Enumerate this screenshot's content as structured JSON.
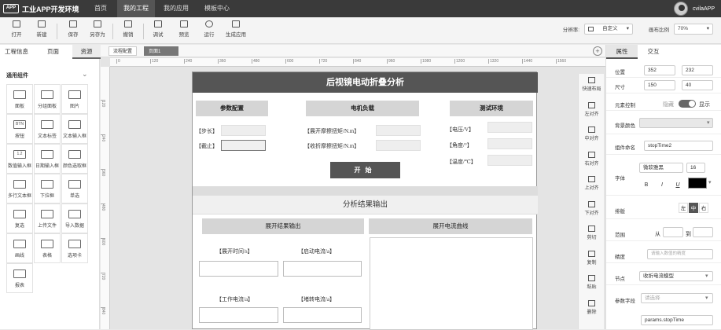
{
  "app": {
    "title": "工业APP开发环境",
    "logo_text": "APP"
  },
  "nav": {
    "tabs": [
      "首页",
      "我的工程",
      "我的应用",
      "模板中心"
    ],
    "active": 1
  },
  "user": {
    "name": "cvilaAPP"
  },
  "toolbar": {
    "buttons": [
      "打开",
      "新建",
      "保存",
      "另存为",
      "撤销",
      "调试",
      "预览",
      "运行",
      "生成应用"
    ],
    "resolution_label": "分辨率:",
    "resolution_value": "自定义",
    "zoom_label": "画布比例",
    "zoom_value": "70%"
  },
  "left_panel": {
    "tabs": [
      "工程信息",
      "页面",
      "资源"
    ],
    "active_tab": 2,
    "section_title": "通用组件",
    "components": [
      {
        "label": "面板",
        "icon": "panel-icon",
        "glyph": ""
      },
      {
        "label": "分组面板",
        "icon": "group-panel-icon",
        "glyph": ""
      },
      {
        "label": "图片",
        "icon": "image-icon",
        "glyph": ""
      },
      {
        "label": "按钮",
        "icon": "button-icon",
        "glyph": "BTN"
      },
      {
        "label": "文本标签",
        "icon": "text-label-icon",
        "glyph": ""
      },
      {
        "label": "文本输入框",
        "icon": "text-input-icon",
        "glyph": ""
      },
      {
        "label": "数值输入框",
        "icon": "number-input-icon",
        "glyph": "1.2"
      },
      {
        "label": "日期输入框",
        "icon": "date-input-icon",
        "glyph": ""
      },
      {
        "label": "颜色选取框",
        "icon": "color-picker-icon",
        "glyph": ""
      },
      {
        "label": "多行文本框",
        "icon": "textarea-icon",
        "glyph": ""
      },
      {
        "label": "下拉框",
        "icon": "dropdown-icon",
        "glyph": ""
      },
      {
        "label": "单选",
        "icon": "radio-icon",
        "glyph": ""
      },
      {
        "label": "复选",
        "icon": "checkbox-icon",
        "glyph": ""
      },
      {
        "label": "上传文件",
        "icon": "upload-icon",
        "glyph": ""
      },
      {
        "label": "导入数据",
        "icon": "import-icon",
        "glyph": ""
      },
      {
        "label": "画线",
        "icon": "line-icon",
        "glyph": ""
      },
      {
        "label": "表格",
        "icon": "table-icon",
        "glyph": ""
      },
      {
        "label": "选项卡",
        "icon": "tabs-icon",
        "glyph": ""
      },
      {
        "label": "报表",
        "icon": "report-icon",
        "glyph": ""
      }
    ]
  },
  "canvas": {
    "tabs": [
      "流程配置",
      "页面1"
    ],
    "active_tab": 1,
    "ruler_h": [
      "0",
      "120",
      "240",
      "360",
      "480",
      "600",
      "720",
      "840",
      "960",
      "1080",
      "1200",
      "1320",
      "1440",
      "1560"
    ],
    "ruler_v": [
      "120",
      "240",
      "360",
      "480",
      "600",
      "720",
      "840"
    ]
  },
  "design": {
    "title": "后视镜电动折叠分析",
    "sections": [
      "参数配置",
      "电机负载",
      "测试环境"
    ],
    "param_fields": [
      "【步长】",
      "【截止】"
    ],
    "motor_fields": [
      "【展开摩擦扭矩/N.m】",
      "【收折摩擦扭矩/N.m】"
    ],
    "env_fields": [
      "【电压/V】",
      "【角度/°】",
      "【温度/℃】"
    ],
    "start_button": "开始",
    "analysis_title": "分析结果输出",
    "result_sections": [
      "展开结果输出",
      "展开电流曲线"
    ],
    "result_fields": [
      "【展开时间/s】",
      "【启动电流/a】",
      "【工作电流/a】",
      "【堵转电流/a】"
    ]
  },
  "icon_column": [
    "快速布局",
    "左对齐",
    "中对齐",
    "右对齐",
    "上对齐",
    "下对齐",
    "剪切",
    "复制",
    "粘贴",
    "删除"
  ],
  "right_panel": {
    "tabs": [
      "属性",
      "交互"
    ],
    "active_tab": 0,
    "position": {
      "label": "位置",
      "x": "352",
      "y": "232"
    },
    "size": {
      "label": "尺寸",
      "w": "150",
      "h": "40"
    },
    "element_control": {
      "label": "元素控制",
      "hide": "隐藏",
      "show": "显示"
    },
    "background": {
      "label": "背景颜色"
    },
    "name": {
      "label": "组件命名",
      "value": "stopTime2"
    },
    "font": {
      "label": "字体",
      "family": "微软雅黑",
      "size": "16",
      "bold": "B",
      "italic": "I",
      "underline": "U",
      "color": "#000000"
    },
    "layout": {
      "label": "排版",
      "options": [
        "左",
        "中",
        "右"
      ],
      "active": 1
    },
    "range": {
      "label": "范围",
      "from": "从",
      "to": "到"
    },
    "precision": {
      "label": "精度",
      "placeholder": "请输入数值的精度"
    },
    "node": {
      "label": "节点",
      "value": "收折电流模型"
    },
    "param_field": {
      "label": "参数字段",
      "placeholder": "请选择",
      "value": "params.stopTime"
    }
  }
}
